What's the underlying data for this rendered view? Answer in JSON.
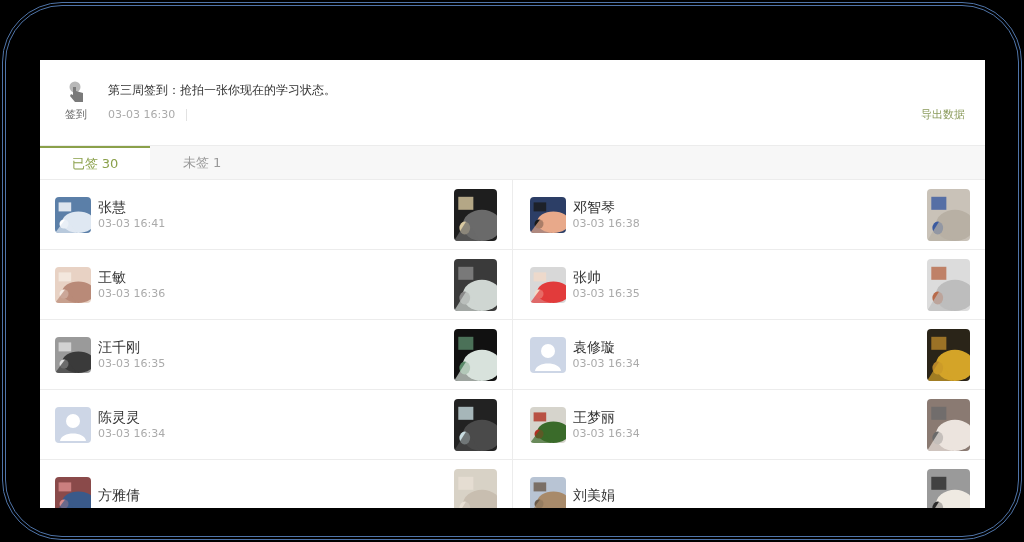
{
  "activity": {
    "type_label": "签到",
    "title": "第三周签到：抢拍一张你现在的学习状态。",
    "time": "03-03 16:30",
    "export_link": "导出数据"
  },
  "tabs": [
    {
      "label": "已签 30",
      "selected": true
    },
    {
      "label": "未签 1",
      "selected": false
    }
  ],
  "entries": [
    {
      "name": "张慧",
      "time": "03-03 16:41"
    },
    {
      "name": "邓智琴",
      "time": "03-03 16:38"
    },
    {
      "name": "王敏",
      "time": "03-03 16:36"
    },
    {
      "name": "张帅",
      "time": "03-03 16:35"
    },
    {
      "name": "汪千刚",
      "time": "03-03 16:35"
    },
    {
      "name": "袁修璇",
      "time": "03-03 16:34",
      "kind": "default"
    },
    {
      "name": "陈灵灵",
      "time": "03-03 16:34",
      "kind": "default"
    },
    {
      "name": "王梦丽",
      "time": "03-03 16:34"
    },
    {
      "name": "方雅倩"
    },
    {
      "name": "刘美娟"
    }
  ]
}
